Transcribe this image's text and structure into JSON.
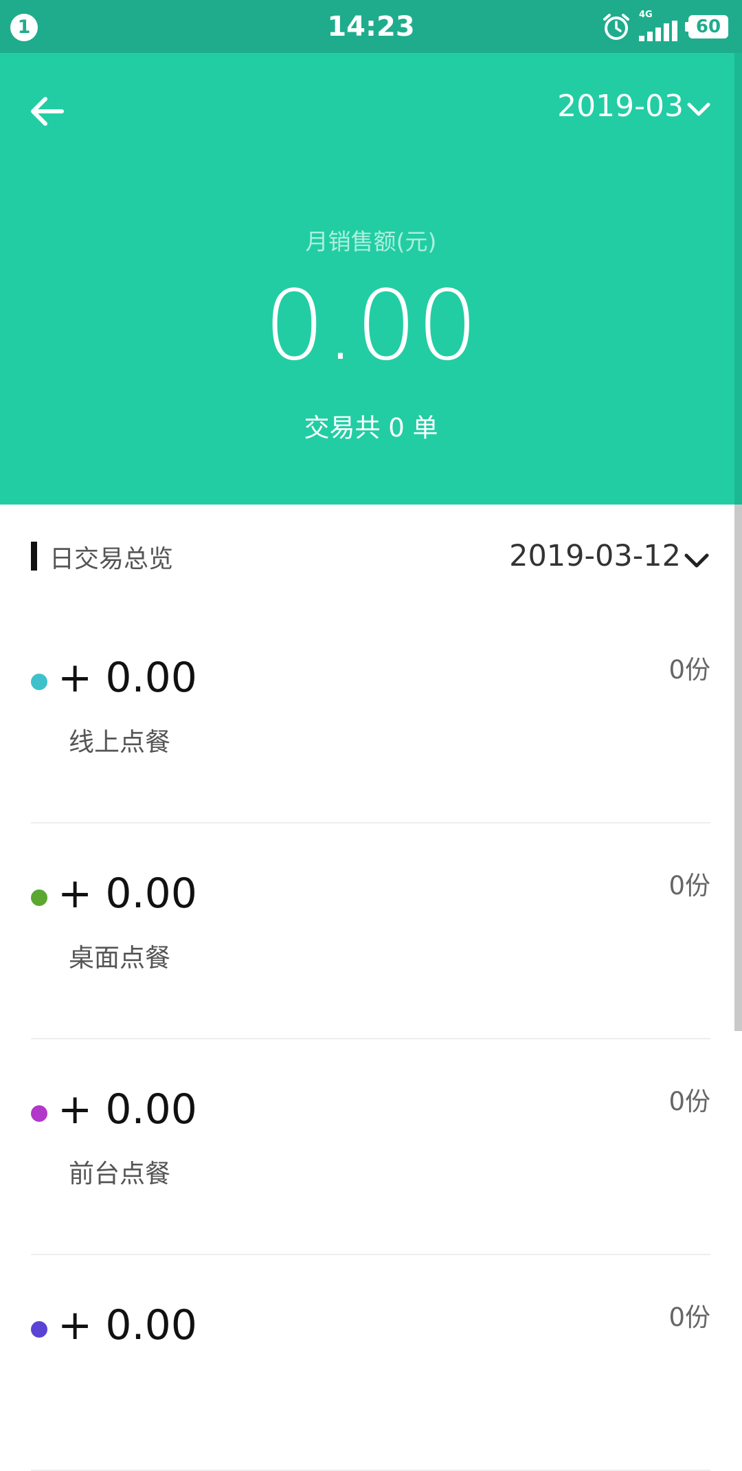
{
  "status_bar": {
    "notification_count": "1",
    "time": "14:23",
    "network": "4G",
    "battery": "60"
  },
  "header": {
    "month": "2019-03",
    "label": "月销售额(元)",
    "amount": "0.00",
    "orders_text": "交易共 0 单"
  },
  "daily": {
    "title": "日交易总览",
    "date": "2019-03-12",
    "rows": [
      {
        "amount": "+ 0.00",
        "channel": "线上点餐",
        "qty": "0份",
        "color": "#3ec1cb"
      },
      {
        "amount": "+ 0.00",
        "channel": "桌面点餐",
        "qty": "0份",
        "color": "#5aa832"
      },
      {
        "amount": "+ 0.00",
        "channel": "前台点餐",
        "qty": "0份",
        "color": "#b138c8"
      },
      {
        "amount": "+ 0.00",
        "channel": "",
        "qty": "0份",
        "color": "#5b43d6"
      }
    ]
  },
  "colors": {
    "status_bar": "#1fac8c",
    "header": "#22cda4"
  },
  "icons": [
    "back-arrow-icon",
    "chevron-down-icon",
    "alarm-icon",
    "signal-icon"
  ]
}
